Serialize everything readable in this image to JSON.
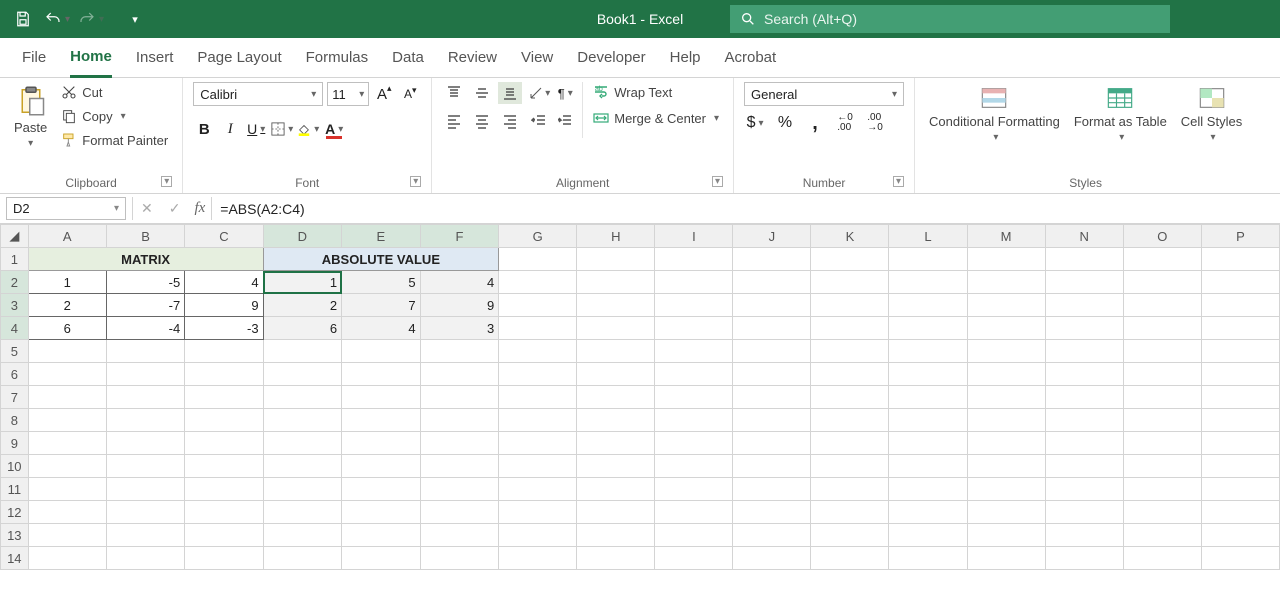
{
  "window": {
    "title": "Book1 - Excel"
  },
  "search": {
    "placeholder": "Search (Alt+Q)"
  },
  "tabs": [
    "File",
    "Home",
    "Insert",
    "Page Layout",
    "Formulas",
    "Data",
    "Review",
    "View",
    "Developer",
    "Help",
    "Acrobat"
  ],
  "active_tab": "Home",
  "ribbon": {
    "clipboard": {
      "paste": "Paste",
      "cut": "Cut",
      "copy": "Copy",
      "painter": "Format Painter",
      "label": "Clipboard"
    },
    "font": {
      "name": "Calibri",
      "size": "11",
      "label": "Font"
    },
    "alignment": {
      "wrap": "Wrap Text",
      "merge": "Merge & Center",
      "label": "Alignment"
    },
    "number": {
      "format": "General",
      "label": "Number"
    },
    "styles": {
      "cond": "Conditional Formatting",
      "table": "Format as Table",
      "cell": "Cell Styles",
      "label": "Styles"
    }
  },
  "formula_bar": {
    "cell_ref": "D2",
    "formula": "=ABS(A2:C4)"
  },
  "columns": [
    "A",
    "B",
    "C",
    "D",
    "E",
    "F",
    "G",
    "H",
    "I",
    "J",
    "K",
    "L",
    "M",
    "N",
    "O",
    "P"
  ],
  "rows": 14,
  "headers": {
    "matrix": "MATRIX",
    "abs": "ABSOLUTE VALUE"
  },
  "matrix": [
    [
      1,
      -5,
      4
    ],
    [
      2,
      -7,
      9
    ],
    [
      6,
      -4,
      -3
    ]
  ],
  "absval": [
    [
      1,
      5,
      4
    ],
    [
      2,
      7,
      9
    ],
    [
      6,
      4,
      3
    ]
  ],
  "selection": {
    "active": "D2",
    "range": "D2:F4"
  },
  "chart_data": {
    "type": "table",
    "title": "MATRIX and ABSOLUTE VALUE",
    "series": [
      {
        "name": "MATRIX",
        "rows": [
          [
            1,
            -5,
            4
          ],
          [
            2,
            -7,
            9
          ],
          [
            6,
            -4,
            -3
          ]
        ]
      },
      {
        "name": "ABSOLUTE VALUE",
        "rows": [
          [
            1,
            5,
            4
          ],
          [
            2,
            7,
            9
          ],
          [
            6,
            4,
            3
          ]
        ]
      }
    ]
  }
}
